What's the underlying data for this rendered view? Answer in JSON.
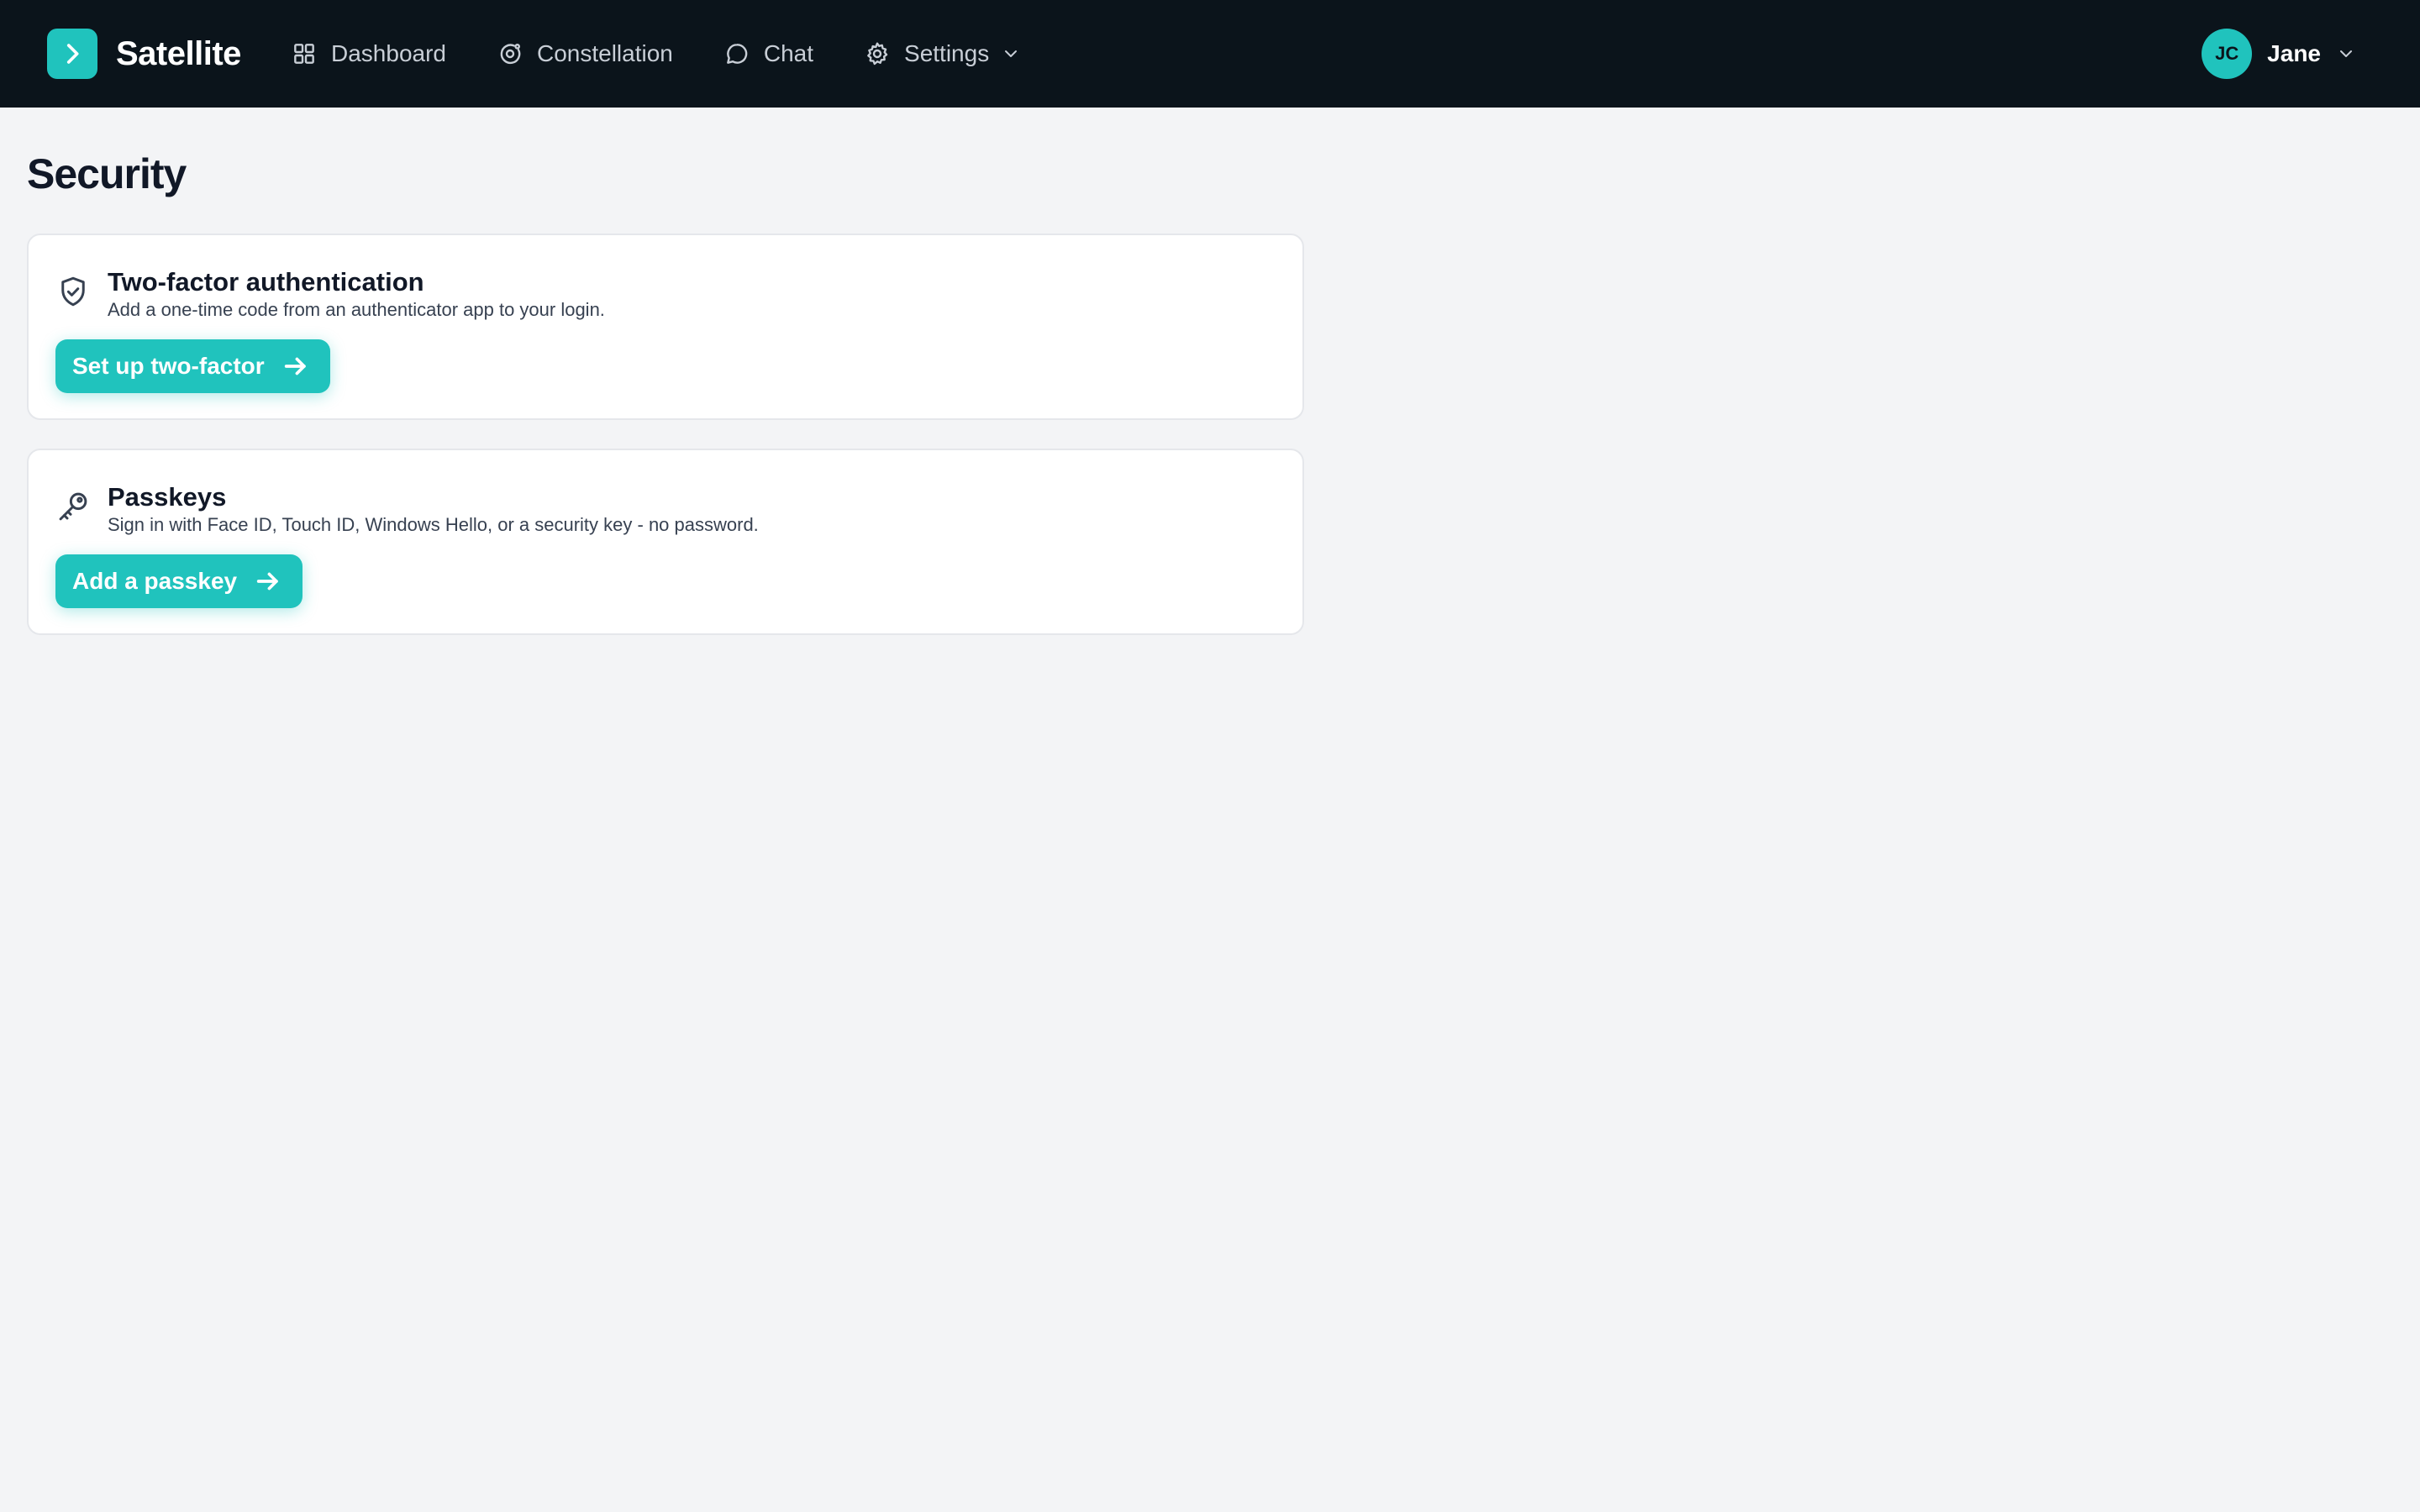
{
  "app": {
    "name": "Satellite",
    "accent": "#20c3bd",
    "topbar_bg": "#0b141b"
  },
  "nav": {
    "items": [
      {
        "label": "Dashboard",
        "icon": "grid-icon"
      },
      {
        "label": "Constellation",
        "icon": "orbit-icon"
      },
      {
        "label": "Chat",
        "icon": "chat-bubble-icon"
      },
      {
        "label": "Settings",
        "icon": "gear-icon"
      }
    ]
  },
  "user": {
    "initials": "JC",
    "name": "Jane"
  },
  "page": {
    "title": "Security"
  },
  "cards": {
    "two_factor": {
      "title": "Two-factor authentication",
      "description": "Add a one-time code from an authenticator app to your login.",
      "button": "Set up two-factor",
      "icon": "shield-check-icon"
    },
    "passkeys": {
      "title": "Passkeys",
      "description": "Sign in with Face ID, Touch ID, Windows Hello, or a security key - no password.",
      "button": "Add a passkey",
      "icon": "key-icon"
    }
  }
}
